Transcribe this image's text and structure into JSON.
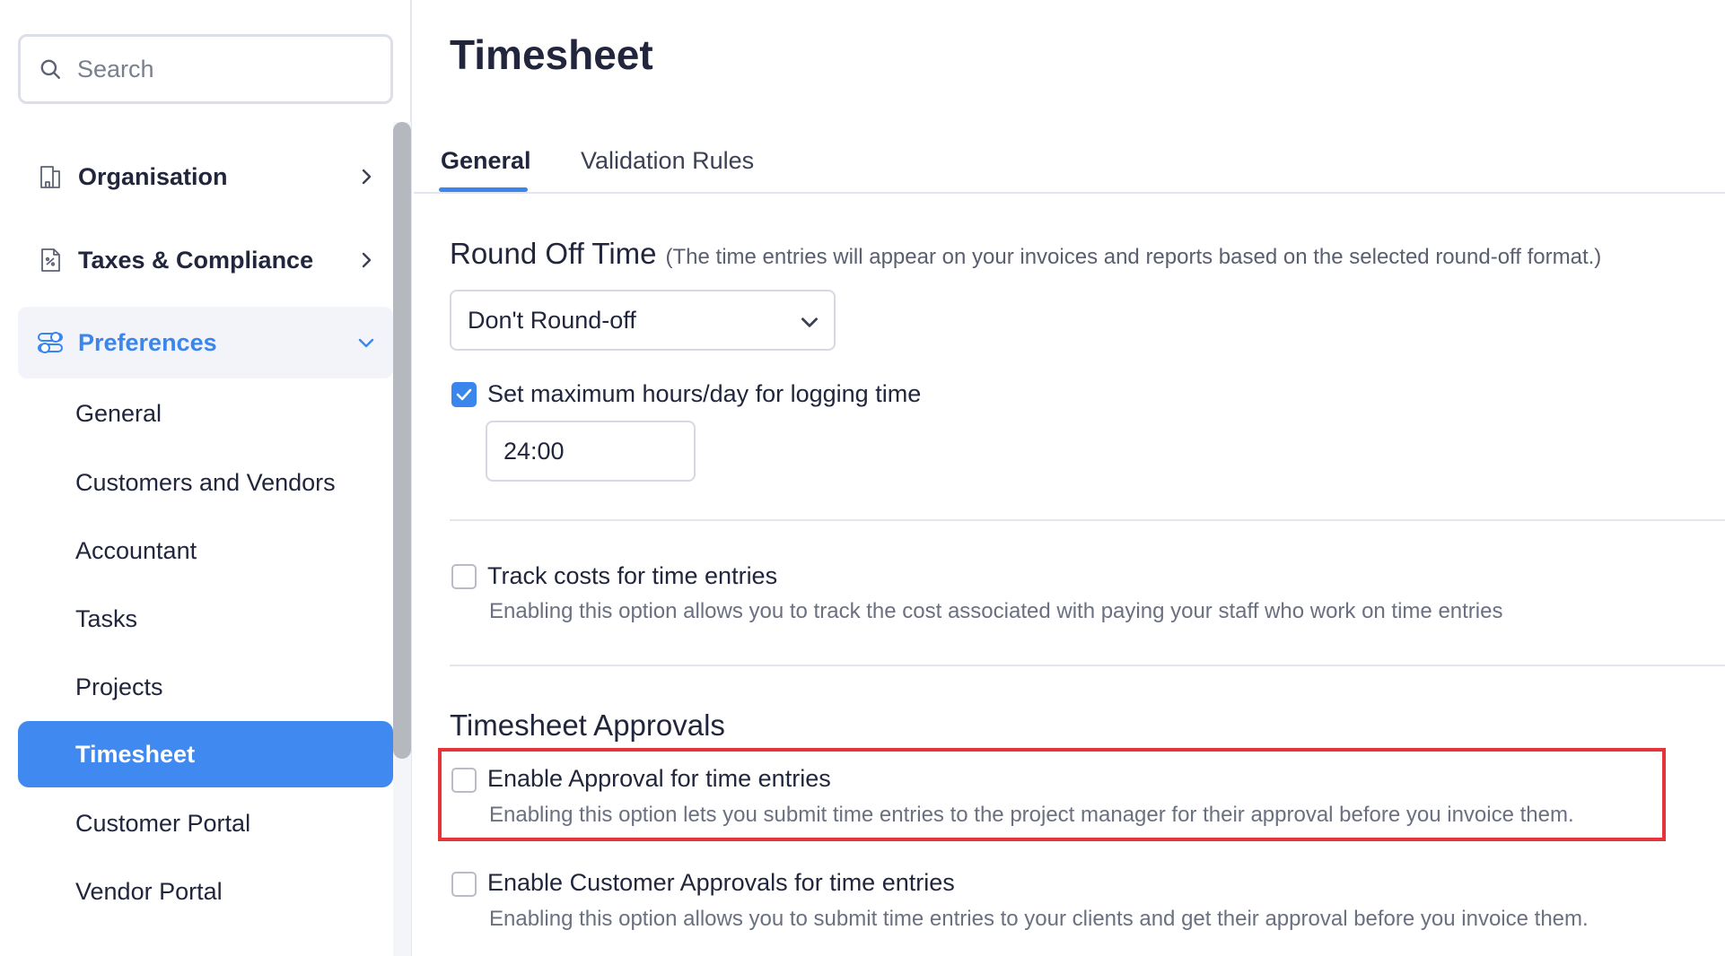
{
  "sidebar": {
    "search_placeholder": "Search",
    "top_items": [
      {
        "label": "Organisation",
        "icon": "building-icon"
      },
      {
        "label": "Taxes & Compliance",
        "icon": "tax-document-icon"
      },
      {
        "label": "Preferences",
        "icon": "preferences-icon"
      }
    ],
    "sub_items": [
      {
        "label": "General"
      },
      {
        "label": "Customers and Vendors"
      },
      {
        "label": "Accountant"
      },
      {
        "label": "Tasks"
      },
      {
        "label": "Projects"
      },
      {
        "label": "Timesheet"
      },
      {
        "label": "Customer Portal"
      },
      {
        "label": "Vendor Portal"
      }
    ]
  },
  "page": {
    "title": "Timesheet",
    "tabs": [
      {
        "label": "General"
      },
      {
        "label": "Validation Rules"
      }
    ],
    "active_tab": "General"
  },
  "round_off": {
    "title": "Round Off Time",
    "note": "(The time entries will appear on your invoices and reports based on the selected round-off format.)",
    "selected": "Don't Round-off"
  },
  "max_hours": {
    "checked": true,
    "label": "Set maximum hours/day for logging time",
    "value": "24:00"
  },
  "track_costs": {
    "checked": false,
    "label": "Track costs for time entries",
    "description": "Enabling this option allows you to track the cost associated with paying your staff who work on time entries"
  },
  "approvals": {
    "title": "Timesheet Approvals",
    "enable_approval": {
      "checked": false,
      "label": "Enable Approval for time entries",
      "description": "Enabling this option lets you submit time entries to the project manager for their approval before you invoice them."
    },
    "customer_approval": {
      "checked": false,
      "label": "Enable Customer Approvals for time entries",
      "description": "Enabling this option allows you to submit time entries to your clients and get their approval before you invoice them."
    }
  },
  "colors": {
    "accent": "#3a86ec",
    "highlight_border": "#e5343a"
  }
}
